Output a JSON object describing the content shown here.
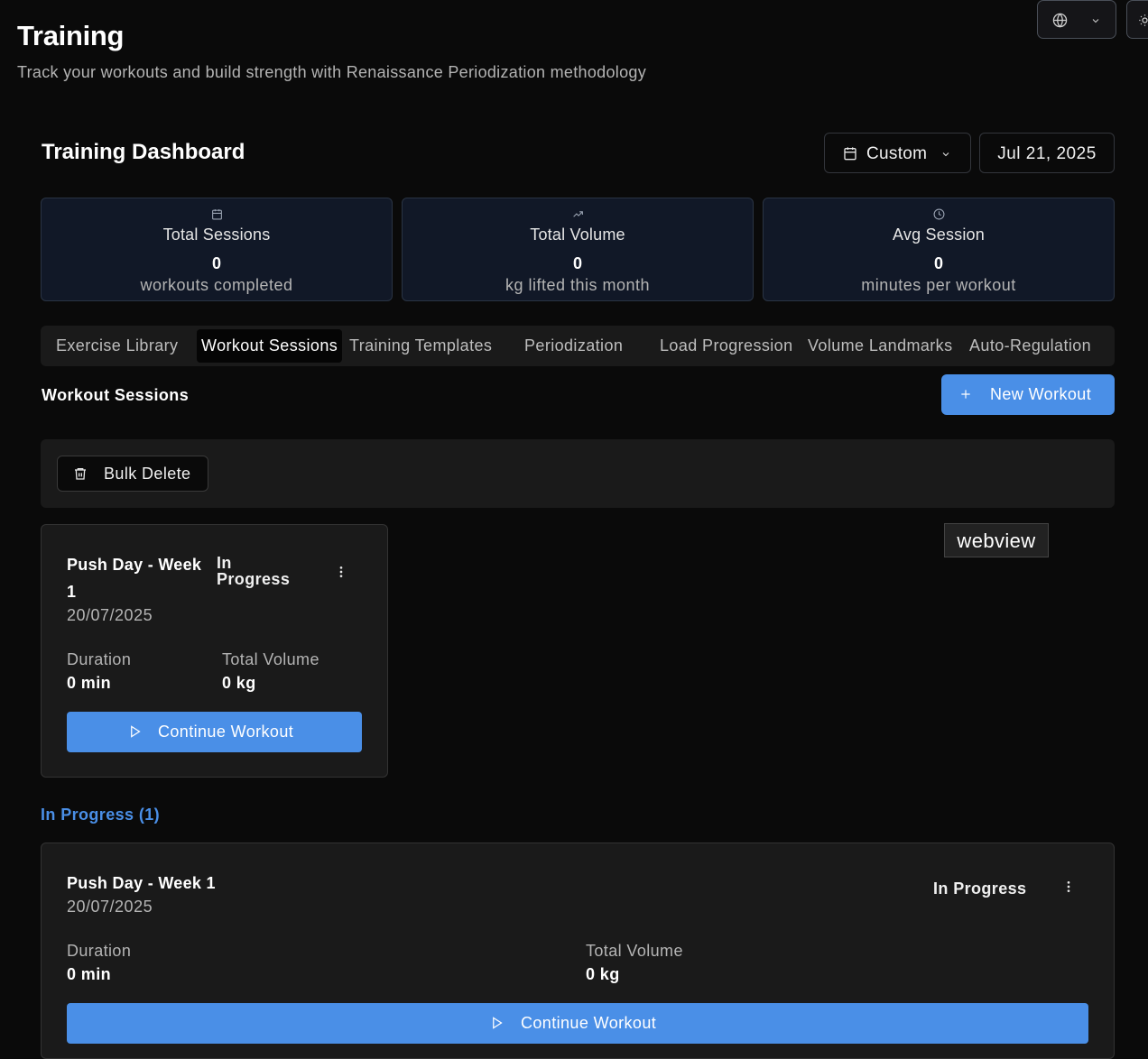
{
  "page": {
    "title": "Training",
    "subtitle": "Track your workouts and build strength with Renaissance Periodization methodology"
  },
  "dashboard": {
    "title": "Training Dashboard",
    "range_label": "Custom",
    "date_label": "Jul 21, 2025"
  },
  "stats": [
    {
      "title": "Total Sessions",
      "value": "0",
      "desc": "workouts completed",
      "icon": "calendar-icon"
    },
    {
      "title": "Total Volume",
      "value": "0",
      "desc": "kg lifted this month",
      "icon": "trending-up-icon"
    },
    {
      "title": "Avg Session",
      "value": "0",
      "desc": "minutes per workout",
      "icon": "clock-icon"
    }
  ],
  "tabs": [
    {
      "label": "Exercise Library",
      "active": false
    },
    {
      "label": "Workout Sessions",
      "active": true
    },
    {
      "label": "Training Templates",
      "active": false
    },
    {
      "label": "Periodization",
      "active": false
    },
    {
      "label": "Load Progression",
      "active": false
    },
    {
      "label": "Volume Landmarks",
      "active": false
    },
    {
      "label": "Auto-Regulation",
      "active": false
    }
  ],
  "sessions": {
    "title": "Workout Sessions",
    "new_label": "New Workout",
    "bulk_delete_label": "Bulk Delete",
    "group_title": "In Progress (1)"
  },
  "cards": [
    {
      "name": "Push Day - Week 1",
      "date": "20/07/2025",
      "status": "In Progress",
      "duration_label": "Duration",
      "duration_value": "0 min",
      "volume_label": "Total Volume",
      "volume_value": "0 kg",
      "action_label": "Continue Workout"
    },
    {
      "name": "Push Day - Week 1",
      "date": "20/07/2025",
      "status": "In Progress",
      "duration_label": "Duration",
      "duration_value": "0 min",
      "volume_label": "Total Volume",
      "volume_value": "0 kg",
      "action_label": "Continue Workout"
    }
  ],
  "overlay": {
    "label": "webview"
  },
  "colors": {
    "accent": "#4a8fe7",
    "background": "#0a0a0a",
    "card": "#1a1a1a",
    "stat_card": "#111827"
  }
}
